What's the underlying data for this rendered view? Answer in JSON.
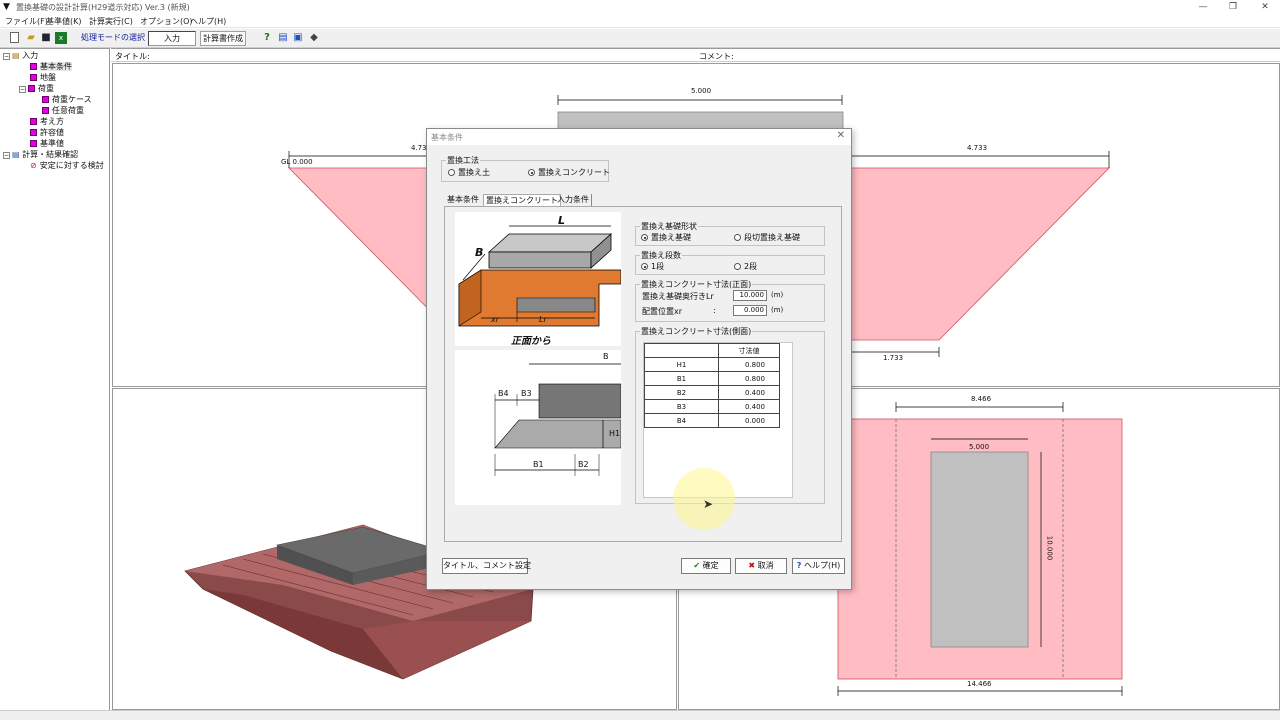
{
  "window": {
    "title": "置換基礎の設計計算(H29道示対応) Ver.3 (新規)",
    "controls": {
      "minimize": "—",
      "restore": "❐",
      "close": "✕"
    }
  },
  "menu": [
    "ファイル(F)",
    "基準値(K)",
    "計算実行(C)",
    "オプション(O)",
    "ヘルプ(H)"
  ],
  "toolbar": {
    "mode_label": "処理モードの選択",
    "mode_value": "入力",
    "report_button": "計算書作成"
  },
  "tree": {
    "root": "入力",
    "items": [
      {
        "label": "基本条件",
        "level": 1
      },
      {
        "label": "地盤",
        "level": 1
      },
      {
        "label": "荷重",
        "level": 1
      },
      {
        "label": "荷重ケース",
        "level": 2
      },
      {
        "label": "任意荷重",
        "level": 2
      },
      {
        "label": "考え方",
        "level": 1
      },
      {
        "label": "許容値",
        "level": 1
      },
      {
        "label": "基準値",
        "level": 1
      }
    ],
    "calc_root": "計算・結果確認",
    "calc_item": "安定に対する検討"
  },
  "header": {
    "title_label": "タイトル:",
    "comment_label": "コメント:"
  },
  "top_view": {
    "dim_top": "5.000",
    "dim_left": "4.733",
    "dim_right": "4.733",
    "gl_label": "GL 0.000",
    "dim_bottom": "1.733"
  },
  "plan_view": {
    "dim_inner": "8.466",
    "dim_block": "5.000",
    "dim_vertical": "10.000",
    "dim_bottom": "14.466"
  },
  "dialog": {
    "title": "基本条件",
    "method_group": "置換工法",
    "method_options": [
      "置換え土",
      "置換えコンクリート"
    ],
    "method_selected": 1,
    "tabs": [
      "基本条件",
      "置換えコンクリート",
      "入力条件"
    ],
    "active_tab": 1,
    "fig1": {
      "L": "L",
      "B": "B",
      "xr": "xr",
      "Lr": "Lr",
      "caption": "正面から"
    },
    "fig2": {
      "B": "B",
      "B4": "B4",
      "B3": "B3",
      "H1": "H1",
      "B1": "B1",
      "B2": "B2"
    },
    "shape_group": "置換え基礎形状",
    "shape_options": [
      "置換え基礎",
      "段切置換え基礎"
    ],
    "shape_selected": 0,
    "steps_group": "置換え段数",
    "steps_options": [
      "1段",
      "2段"
    ],
    "steps_selected": 0,
    "front_group": "置換えコンクリート寸法(正面)",
    "depth_label": "置換え基礎奥行きLr",
    "depth_value": "10.000",
    "depth_unit": "(m)",
    "pos_label": "配置位置xr",
    "pos_value": "0.000",
    "pos_unit": "(m)",
    "side_group": "置換えコンクリート寸法(側面)",
    "table_header": "寸法値",
    "table_rows": [
      {
        "name": "H1",
        "value": "0.800"
      },
      {
        "name": "B1",
        "value": "0.800"
      },
      {
        "name": "B2",
        "value": "0.400"
      },
      {
        "name": "B3",
        "value": "0.400"
      },
      {
        "name": "B4",
        "value": "0.000"
      }
    ],
    "btn_title_comment": "タイトル、コメント設定",
    "btn_ok": "確定",
    "btn_cancel": "取消",
    "btn_help": "ヘルプ(H)"
  },
  "colors": {
    "pink": "#ffbcc3",
    "gray_block": "#c0c0c0",
    "orange": "#e07a30",
    "tree_square": "#e000e0"
  }
}
